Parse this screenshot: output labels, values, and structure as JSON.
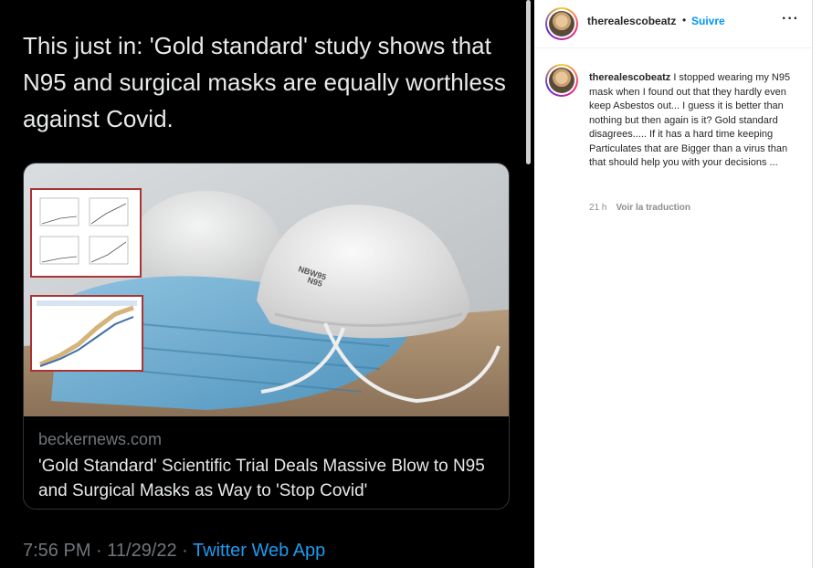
{
  "tweet": {
    "text": "This just in: 'Gold standard' study shows that N95 and surgical masks are equally worthless against Covid.",
    "card": {
      "domain": "beckernews.com",
      "title": "'Gold Standard' Scientific Trial Deals Massive Blow to N95 and Surgical Masks as Way to 'Stop Covid'",
      "mask_label_line1": "NBW95",
      "mask_label_line2": "N95"
    },
    "time": "7:56 PM · 11/29/22 · ",
    "source": "Twitter Web App"
  },
  "post": {
    "username": "therealescobeatz",
    "separator": "•",
    "follow_label": "Suivre",
    "more_label": "···",
    "caption_username": "therealescobeatz",
    "caption_text": " I stopped wearing my N95 mask when I found out that they hardly even keep Asbestos out... I guess it is better than nothing but then again is it? Gold standard disagrees..... If it has a hard time keeping Particulates that are Bigger than a virus than that should help you with your decisions ...",
    "time_ago": "21 h",
    "translate_label": "Voir la traduction"
  },
  "colors": {
    "tweet_bg": "#000000",
    "link_blue": "#1d9bf0",
    "follow_blue": "#0095f6"
  },
  "icons": [
    "more-options-icon",
    "avatar-image"
  ]
}
